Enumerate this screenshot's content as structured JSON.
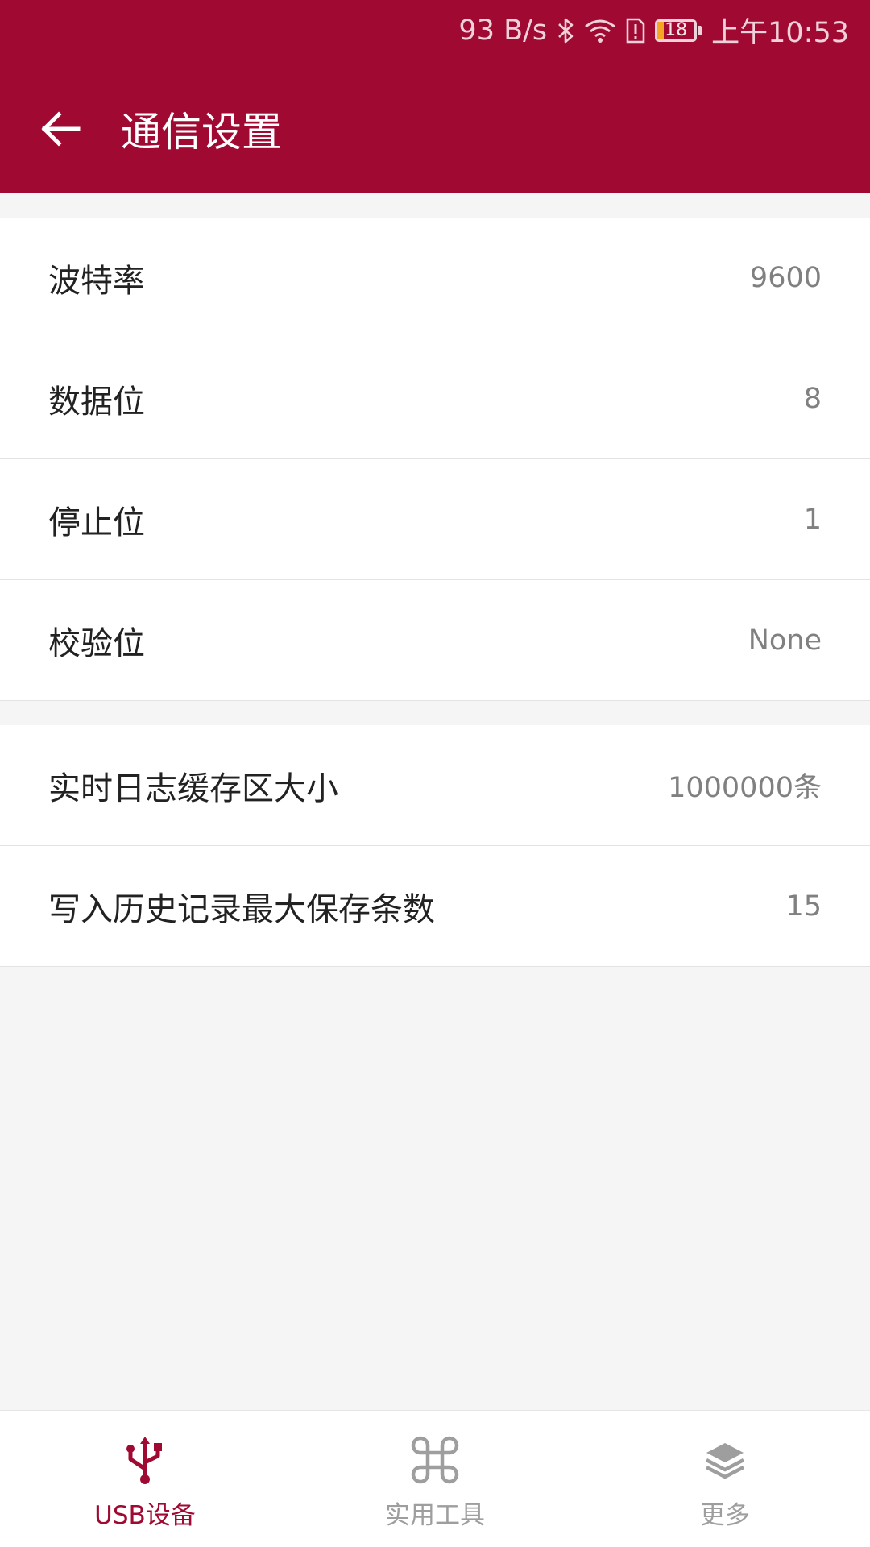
{
  "status_bar": {
    "network_speed": "93 B/s",
    "battery_level": "18",
    "time": "上午10:53"
  },
  "header": {
    "title": "通信设置"
  },
  "settings_group_1": [
    {
      "label": "波特率",
      "value": "9600"
    },
    {
      "label": "数据位",
      "value": "8"
    },
    {
      "label": "停止位",
      "value": "1"
    },
    {
      "label": "校验位",
      "value": "None"
    }
  ],
  "settings_group_2": [
    {
      "label": "实时日志缓存区大小",
      "value": "1000000条"
    },
    {
      "label": "写入历史记录最大保存条数",
      "value": "15"
    }
  ],
  "bottom_nav": [
    {
      "label": "USB设备",
      "icon": "usb-icon",
      "active": true
    },
    {
      "label": "实用工具",
      "icon": "command-icon",
      "active": false
    },
    {
      "label": "更多",
      "icon": "layers-icon",
      "active": false
    }
  ],
  "colors": {
    "brand": "#a00a32",
    "battery": "#f5a623"
  }
}
